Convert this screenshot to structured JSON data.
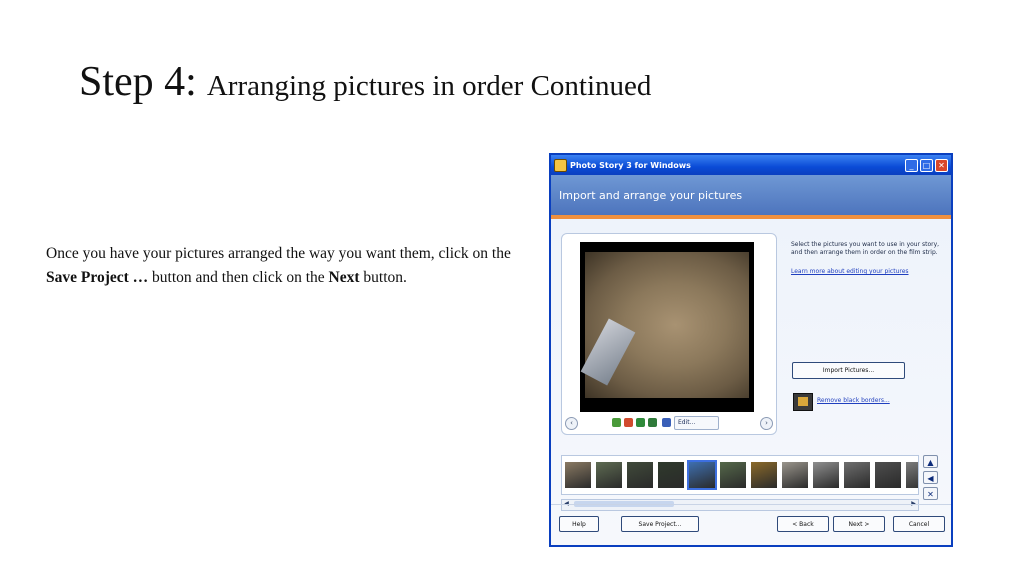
{
  "slide": {
    "title_step": "Step 4:",
    "title_rest": "Arranging pictures in order Continued",
    "body_part1": "Once you have your pictures arranged the way you want them, click on the ",
    "body_bold1": "Save Project …",
    "body_part2": " button and then click on the ",
    "body_bold2": "Next",
    "body_part3": " button."
  },
  "window": {
    "title": "Photo Story 3 for Windows",
    "minimize_glyph": "_",
    "maximize_glyph": "□",
    "close_glyph": "✕",
    "header": "Import and arrange your pictures",
    "instructions": "Select the pictures you want to use in your story, and then arrange them in order on the film strip.",
    "learn_more_link": "Learn more about editing your pictures",
    "import_button": "Import Pictures...",
    "remove_borders_link": "Remove black borders...",
    "edit_button": "Edit...",
    "prev_glyph": "‹",
    "next_glyph": "›",
    "move_up_glyph": "▲",
    "move_left_glyph": "◀",
    "delete_glyph": "✕",
    "scroll_left_glyph": "◀",
    "scroll_right_glyph": "▶",
    "buttons": {
      "help": "Help",
      "save_project": "Save Project...",
      "back": "< Back",
      "next": "Next >",
      "cancel": "Cancel"
    },
    "thumbnail_colors": [
      "#8a7a63",
      "#5e6b52",
      "#404a3a",
      "#2f3a2c",
      "#3e6fb0",
      "#55684a",
      "#8b6a2a",
      "#9a958c",
      "#8f8f8f",
      "#6e6e6e",
      "#4e4e4e",
      "#7b7b7b"
    ],
    "selected_thumbnail_index": 4
  }
}
